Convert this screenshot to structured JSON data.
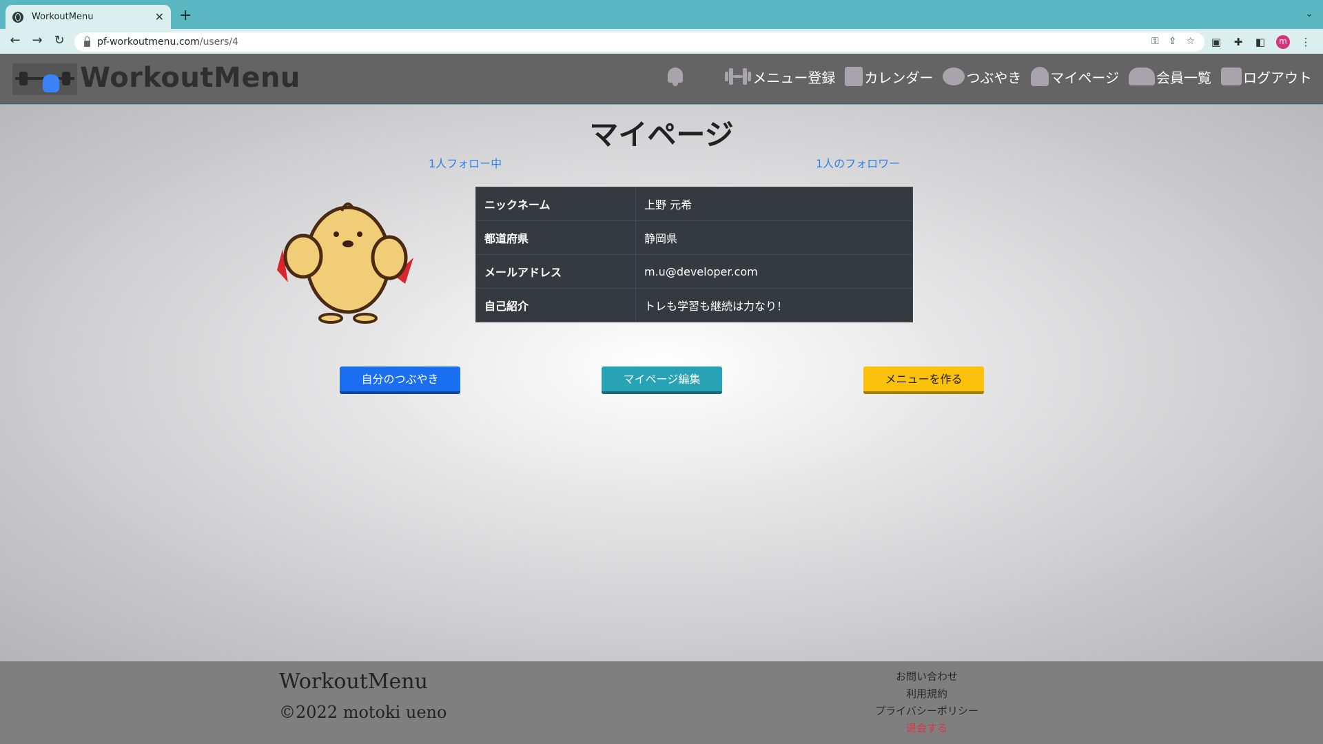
{
  "browser": {
    "tab_title": "WorkoutMenu",
    "tab_close": "✕",
    "new_tab": "+",
    "tab_menu": "⌄",
    "url_host": "pf-workoutmenu.com",
    "url_path": "/users/4",
    "profile_initial": "m"
  },
  "header": {
    "brand": "WorkoutMenu",
    "nav": {
      "menu_register": "メニュー登録",
      "calendar": "カレンダー",
      "tweets": "つぶやき",
      "mypage": "マイページ",
      "members": "会員一覧",
      "logout": "ログアウト"
    }
  },
  "main": {
    "title": "マイページ",
    "following": "1人フォロー中",
    "followers": "1人のフォロワー",
    "profile": {
      "nickname_label": "ニックネーム",
      "nickname": "上野 元希",
      "prefecture_label": "都道府県",
      "prefecture": "静岡県",
      "email_label": "メールアドレス",
      "email": "m.u@developer.com",
      "intro_label": "自己紹介",
      "intro": "トレも学習も継続は力なり！"
    },
    "buttons": {
      "my_tweets": "自分のつぶやき",
      "edit_mypage": "マイページ編集",
      "create_menu": "メニューを作る"
    }
  },
  "footer": {
    "brand": "WorkoutMenu",
    "copyright": "©2022 motoki ueno",
    "links": {
      "contact": "お問い合わせ",
      "terms": "利用規約",
      "privacy": "プライバシーポリシー",
      "withdraw": "退会する"
    }
  },
  "colors": {
    "tab_strip": "#5bb8c2",
    "header_bg": "#646464",
    "footer_bg": "#7f7f7f",
    "btn_primary": "#1a6ff0",
    "btn_info": "#28a3b5",
    "btn_warning": "#fbc10b",
    "link": "#2f7fea",
    "danger": "#dc3545"
  }
}
